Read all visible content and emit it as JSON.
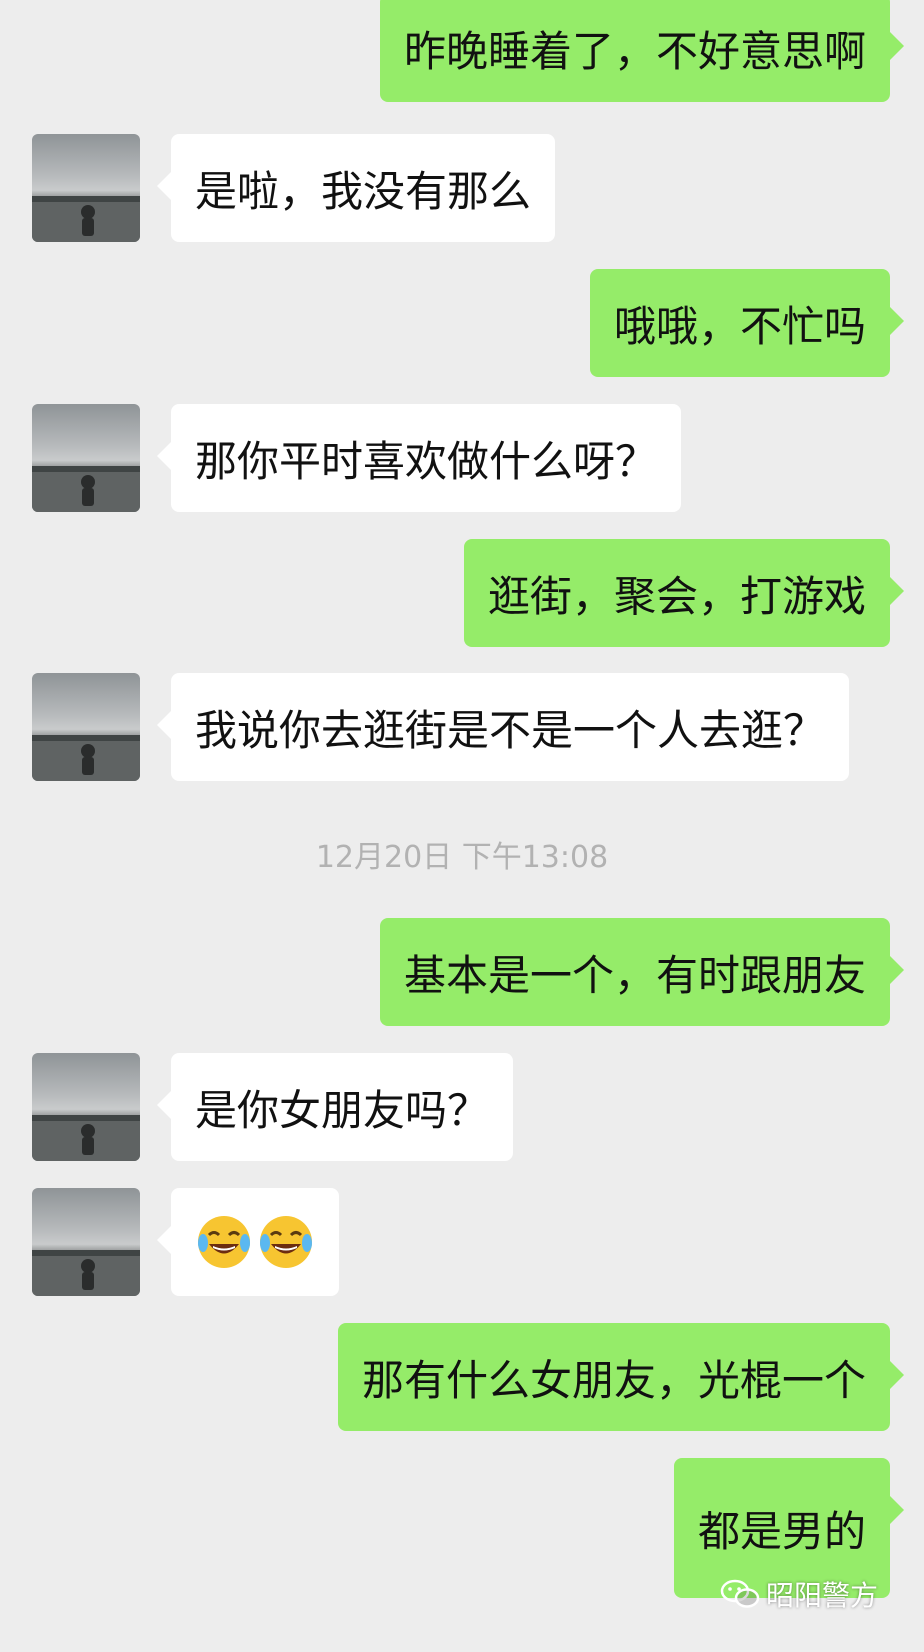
{
  "colors": {
    "background": "#ededed",
    "outgoing_bubble": "#95ec69",
    "incoming_bubble": "#ffffff",
    "timestamp_text": "#b2b2b2"
  },
  "messages": [
    {
      "direction": "outgoing",
      "text": "昨晚睡着了，不好意思啊"
    },
    {
      "direction": "incoming",
      "text": "是啦，我没有那么",
      "avatar": "lake-photo-avatar"
    },
    {
      "direction": "outgoing",
      "text": "哦哦，不忙吗"
    },
    {
      "direction": "incoming",
      "text": "那你平时喜欢做什么呀？",
      "avatar": "lake-photo-avatar"
    },
    {
      "direction": "outgoing",
      "text": "逛街，聚会，打游戏"
    },
    {
      "direction": "incoming",
      "text": "我说你去逛街是不是一个人去逛？",
      "avatar": "lake-photo-avatar"
    },
    {
      "direction": "outgoing",
      "text": "基本是一个，有时跟朋友"
    },
    {
      "direction": "incoming",
      "text": "是你女朋友吗？",
      "avatar": "lake-photo-avatar"
    },
    {
      "direction": "incoming",
      "emoji": [
        "tears-of-joy-emoji",
        "tears-of-joy-emoji"
      ],
      "avatar": "lake-photo-avatar"
    },
    {
      "direction": "outgoing",
      "text": "那有什么女朋友，光棍一个"
    },
    {
      "direction": "outgoing",
      "text": "都是男的"
    }
  ],
  "timestamp": "12月20日 下午13:08",
  "watermark": {
    "icon": "wechat-icon",
    "text": "昭阳警方"
  }
}
